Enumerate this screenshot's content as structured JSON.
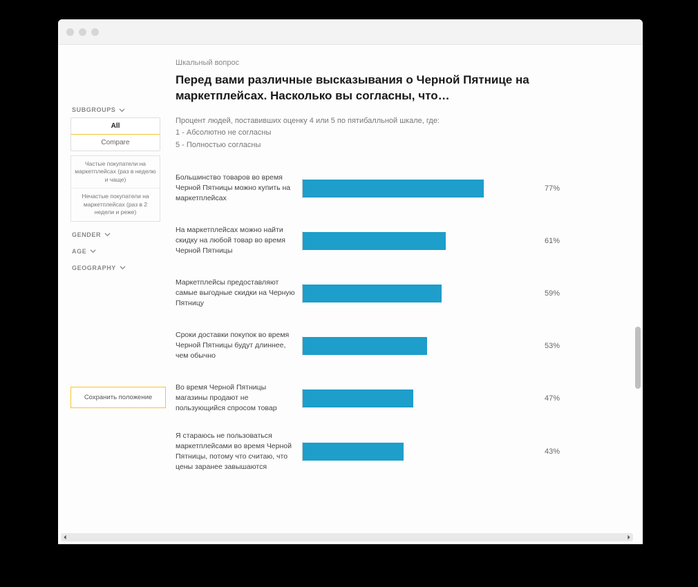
{
  "kicker": "Шкальный вопрос",
  "title": "Перед вами различные высказывания о Черной Пятнице на маркетплейсах. Насколько вы согласны, что…",
  "description_lines": [
    "Процент людей, поставивших оценку 4 или 5 по пятибалльной шкале, где:",
    "1 - Абсолютно не согласны",
    "5 - Полностью согласны"
  ],
  "sidebar": {
    "filters": {
      "subgroups_label": "SUBGROUPS",
      "gender_label": "GENDER",
      "age_label": "AGE",
      "geography_label": "GEOGRAPHY"
    },
    "tabs": {
      "all": "All",
      "compare": "Compare"
    },
    "segments": [
      "Частые покупатели на маркетплейсах (раз в неделю и чаще)",
      "Нечастые покупатели на маркетплейсах (раз в 2 недели и реже)"
    ],
    "save_position": "Сохранить положение"
  },
  "chart_data": {
    "type": "bar",
    "orientation": "horizontal",
    "xlabel": "",
    "ylabel": "",
    "xlim": [
      0,
      100
    ],
    "unit": "%",
    "bar_color": "#1d9ecb",
    "categories": [
      "Большинство товаров во время Черной Пятницы можно купить на маркетплейсах",
      "На маркетплейсах можно найти скидку на любой товар во время Черной Пятницы",
      "Маркетплейсы предоставляют самые выгодные скидки на Черную Пятницу",
      "Сроки доставки покупок во время Черной Пятницы будут длиннее, чем обычно",
      "Во время Черной Пятницы магазины продают не пользующийся спросом товар",
      "Я стараюсь не пользоваться маркетплейсами во время Черной Пятницы, потому что считаю, что цены заранее завышаются"
    ],
    "values": [
      77,
      61,
      59,
      53,
      47,
      43
    ]
  }
}
